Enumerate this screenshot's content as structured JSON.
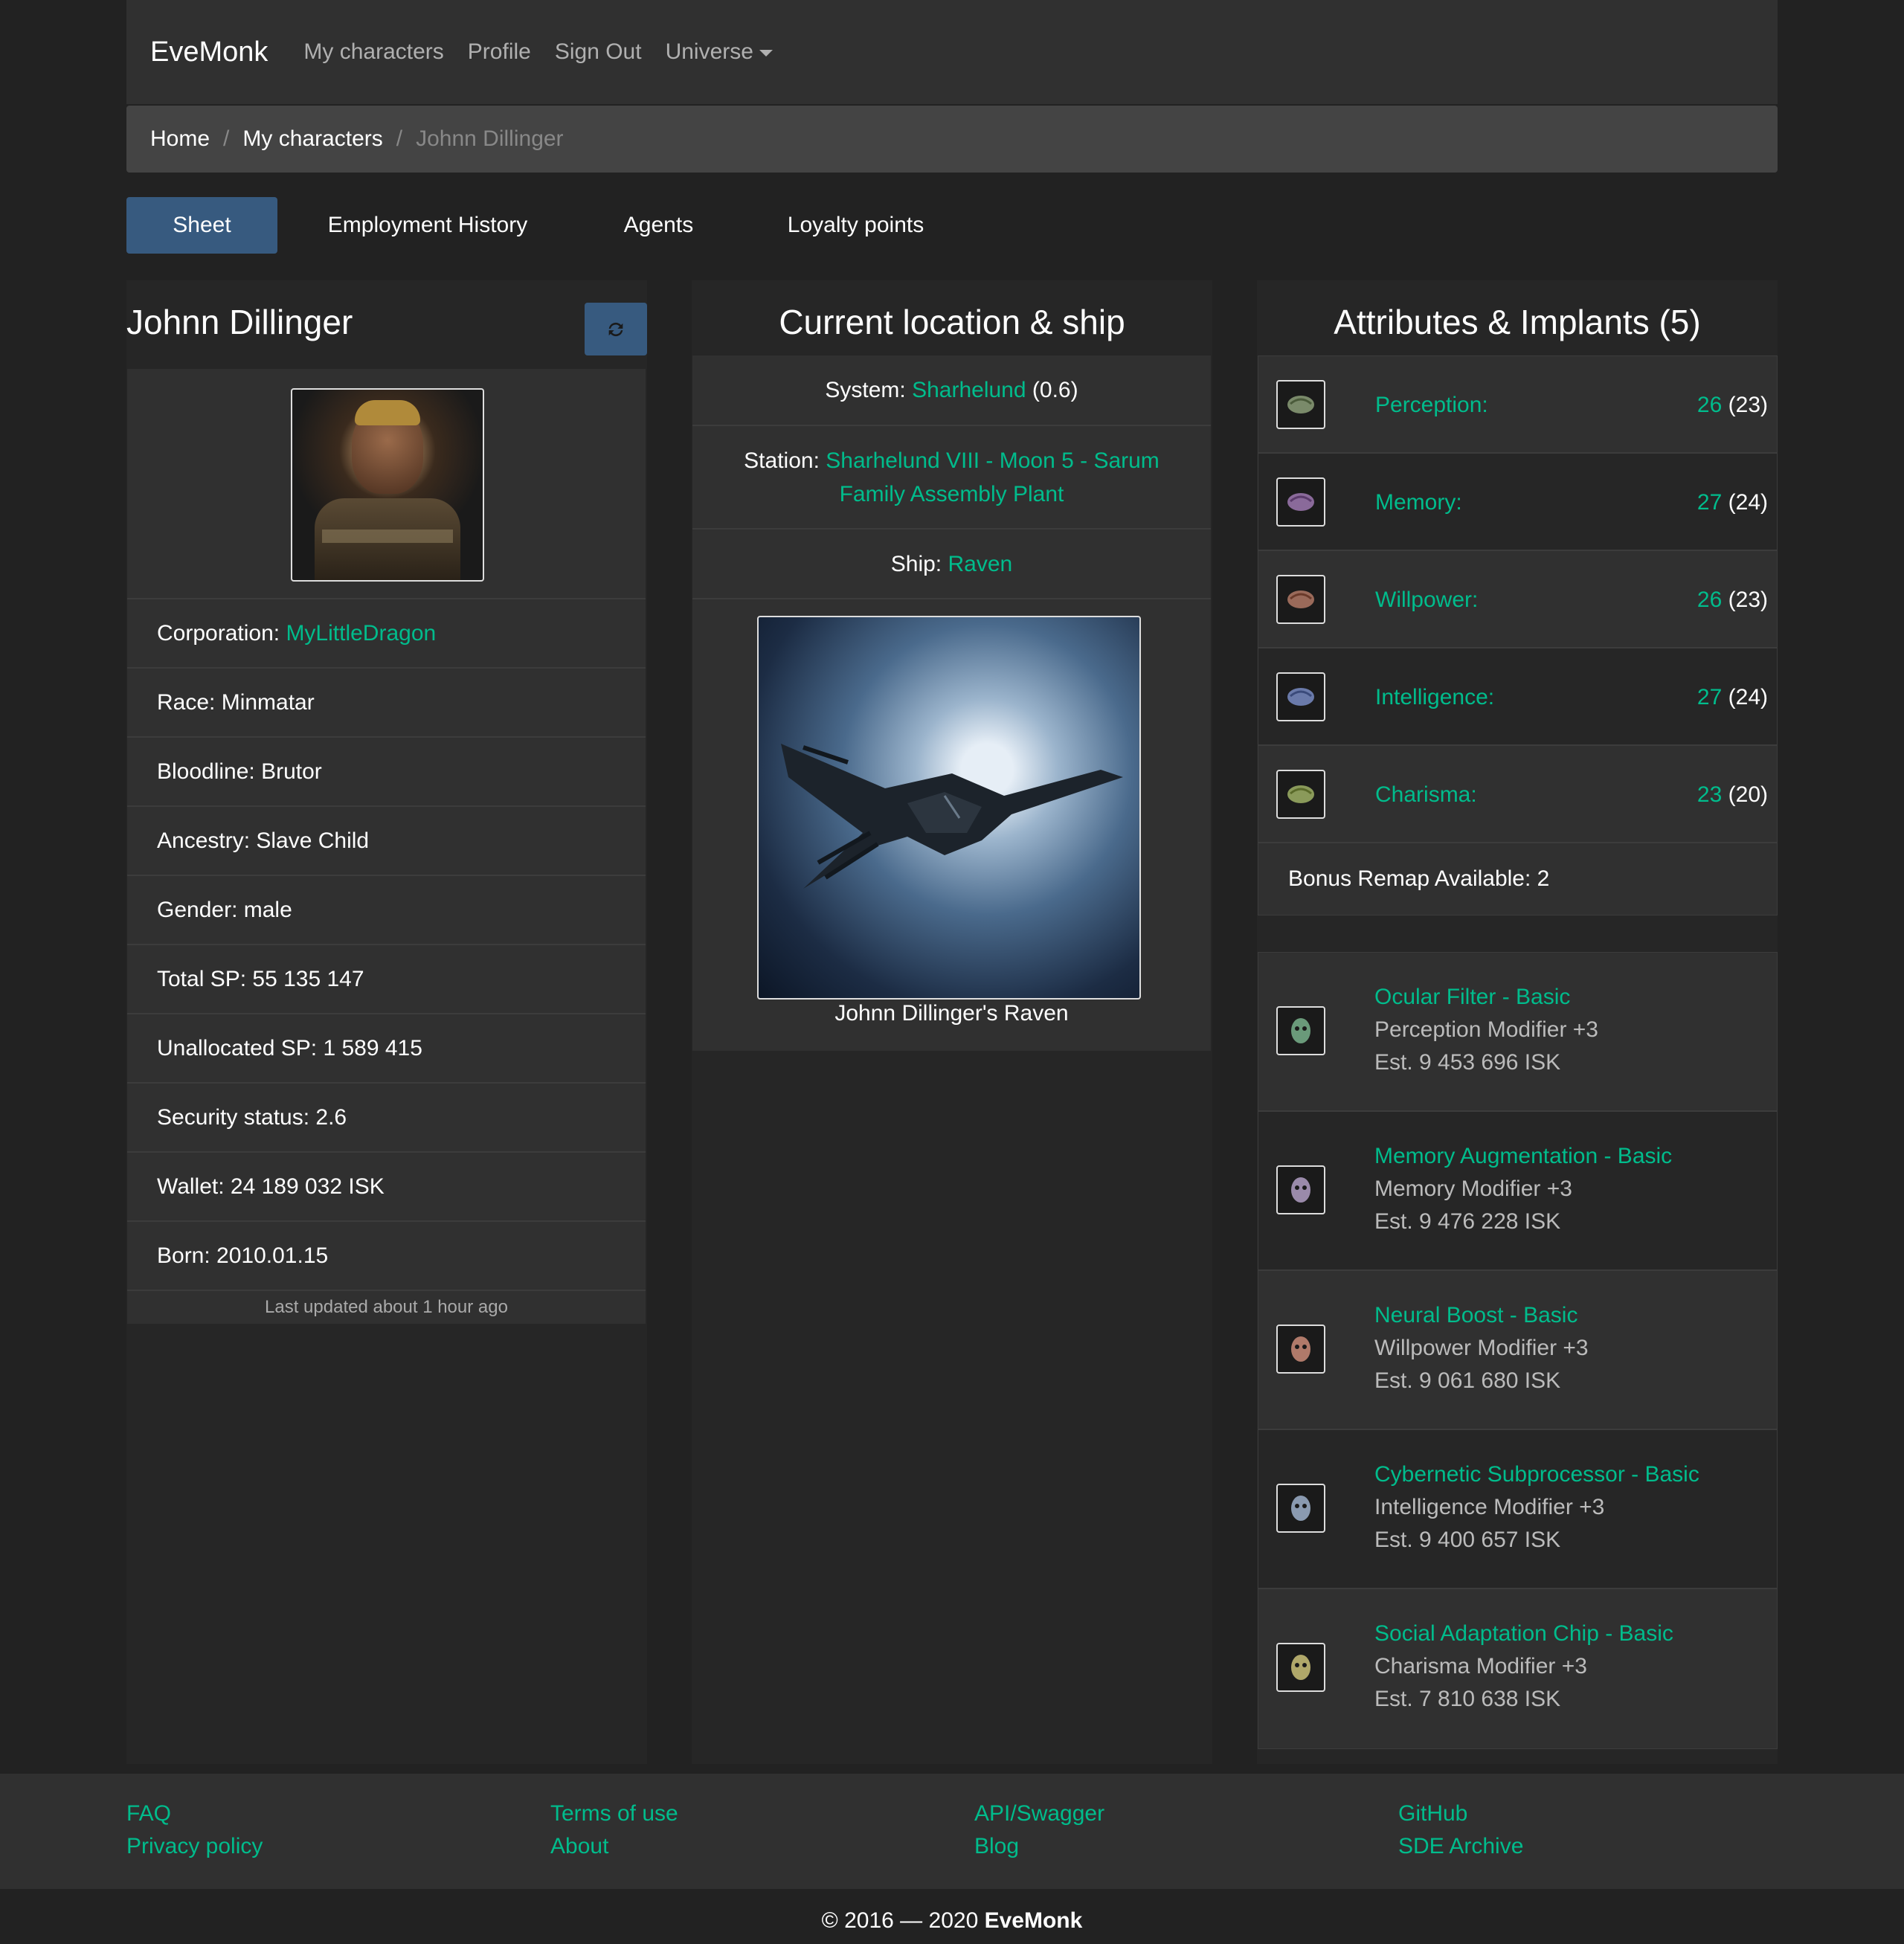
{
  "navbar": {
    "brand": "EveMonk",
    "links": [
      "My characters",
      "Profile",
      "Sign Out",
      "Universe"
    ]
  },
  "breadcrumb": [
    "Home",
    "My characters",
    "Johnn Dillinger"
  ],
  "tabs": [
    "Sheet",
    "Employment History",
    "Agents",
    "Loyalty points"
  ],
  "character": {
    "name": "Johnn Dillinger",
    "refresh_icon": "refresh-icon",
    "corporation_label": "Corporation:",
    "corporation": "MyLittleDragon",
    "race": "Race: Minmatar",
    "bloodline": "Bloodline: Brutor",
    "ancestry": "Ancestry: Slave Child",
    "gender": "Gender: male",
    "total_sp": "Total SP: 55 135 147",
    "unallocated_sp": "Unallocated SP: 1 589 415",
    "security": "Security status: 2.6",
    "wallet": "Wallet: 24 189 032 ISK",
    "born": "Born: 2010.01.15",
    "updated": "Last updated about 1 hour ago"
  },
  "location": {
    "title": "Current location & ship",
    "system_label": "System:",
    "system": "Sharhelund",
    "system_sec": "(0.6)",
    "station_label": "Station:",
    "station_line1": "Sharhelund VIII - Moon 5 - Sarum",
    "station_line2": "Family Assembly Plant",
    "ship_label": "Ship:",
    "ship": "Raven",
    "ship_caption": "Johnn Dillinger's Raven"
  },
  "attributes": {
    "title": "Attributes & Implants (5)",
    "items": [
      {
        "name": "Perception:",
        "value": "26",
        "base": "(23)"
      },
      {
        "name": "Memory:",
        "value": "27",
        "base": "(24)"
      },
      {
        "name": "Willpower:",
        "value": "26",
        "base": "(23)"
      },
      {
        "name": "Intelligence:",
        "value": "27",
        "base": "(24)"
      },
      {
        "name": "Charisma:",
        "value": "23",
        "base": "(20)"
      }
    ],
    "remap": "Bonus Remap Available: 2"
  },
  "implants": [
    {
      "name": "Ocular Filter - Basic",
      "modifier": "Perception Modifier +3",
      "price": "Est. 9 453 696 ISK"
    },
    {
      "name": "Memory Augmentation - Basic",
      "modifier": "Memory Modifier +3",
      "price": "Est. 9 476 228 ISK"
    },
    {
      "name": "Neural Boost - Basic",
      "modifier": "Willpower Modifier +3",
      "price": "Est. 9 061 680 ISK"
    },
    {
      "name": "Cybernetic Subprocessor - Basic",
      "modifier": "Intelligence Modifier +3",
      "price": "Est. 9 400 657 ISK"
    },
    {
      "name": "Social Adaptation Chip - Basic",
      "modifier": "Charisma Modifier +3",
      "price": "Est. 7 810 638 ISK"
    }
  ],
  "footer": {
    "col1": [
      "FAQ",
      "Privacy policy"
    ],
    "col2": [
      "Terms of use",
      "About"
    ],
    "col3": [
      "API/Swagger",
      "Blog"
    ],
    "col4": [
      "GitHub",
      "SDE Archive"
    ],
    "copyright_prefix": "© 2016 — 2020",
    "copyright_brand": "EveMonk"
  },
  "colors": {
    "accent": "#00bc8c",
    "primary": "#375a7f",
    "background": "#222222",
    "panel": "#303030"
  }
}
